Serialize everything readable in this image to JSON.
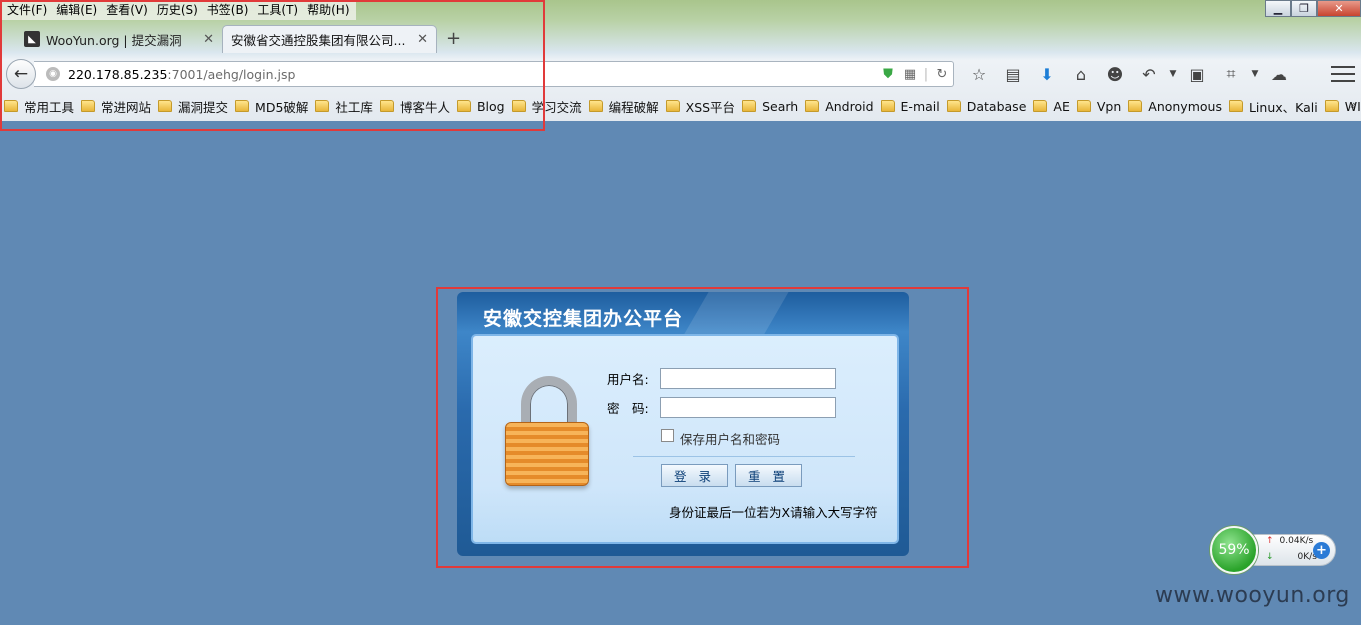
{
  "menubar": [
    "文件(F)",
    "编辑(E)",
    "查看(V)",
    "历史(S)",
    "书签(B)",
    "工具(T)",
    "帮助(H)"
  ],
  "window_controls": {
    "minimize": "▁",
    "maximize": "❐",
    "close": "✕"
  },
  "tabs": [
    {
      "title": "WooYun.org | 提交漏洞",
      "favicon": "wooyun-icon",
      "active": false
    },
    {
      "title": "安徽省交通控股集团有限公司...",
      "favicon": "",
      "active": true
    }
  ],
  "new_tab_label": "+",
  "tab_close_glyph": "✕",
  "url": {
    "host": "220.178.85.235",
    "path": ":7001/aehg/login.jsp"
  },
  "bookmarks": [
    "常用工具",
    "常进网站",
    "漏洞提交",
    "MD5破解",
    "社工库",
    "博客牛人",
    "Blog",
    "学习交流",
    "编程破解",
    "XSS平台",
    "Searh",
    "Android",
    "E-mail",
    "Database",
    "AE",
    "Vpn",
    "Anonymous",
    "Linux、Kali",
    "WIFI"
  ],
  "bookmarks_overflow": "»",
  "login": {
    "title": "安徽交控集团办公平台",
    "username_label": "用户名:",
    "password_label": "密　码:",
    "username_value": "",
    "password_value": "",
    "remember_label": "保存用户名和密码",
    "remember_checked": false,
    "login_button": "登 录",
    "reset_button": "重 置",
    "hint": "身份证最后一位若为X请输入大写字符"
  },
  "net_meter": {
    "percent": "59%",
    "upload": "0.04K/s",
    "download": "0K/s",
    "up_arrow": "↑",
    "down_arrow": "↓",
    "plus": "+"
  },
  "watermark": "www.wooyun.org",
  "colors": {
    "page_bg": "#6089b4",
    "annotation_red": "#e13a3a",
    "panel_blue": "#2a6aad"
  }
}
